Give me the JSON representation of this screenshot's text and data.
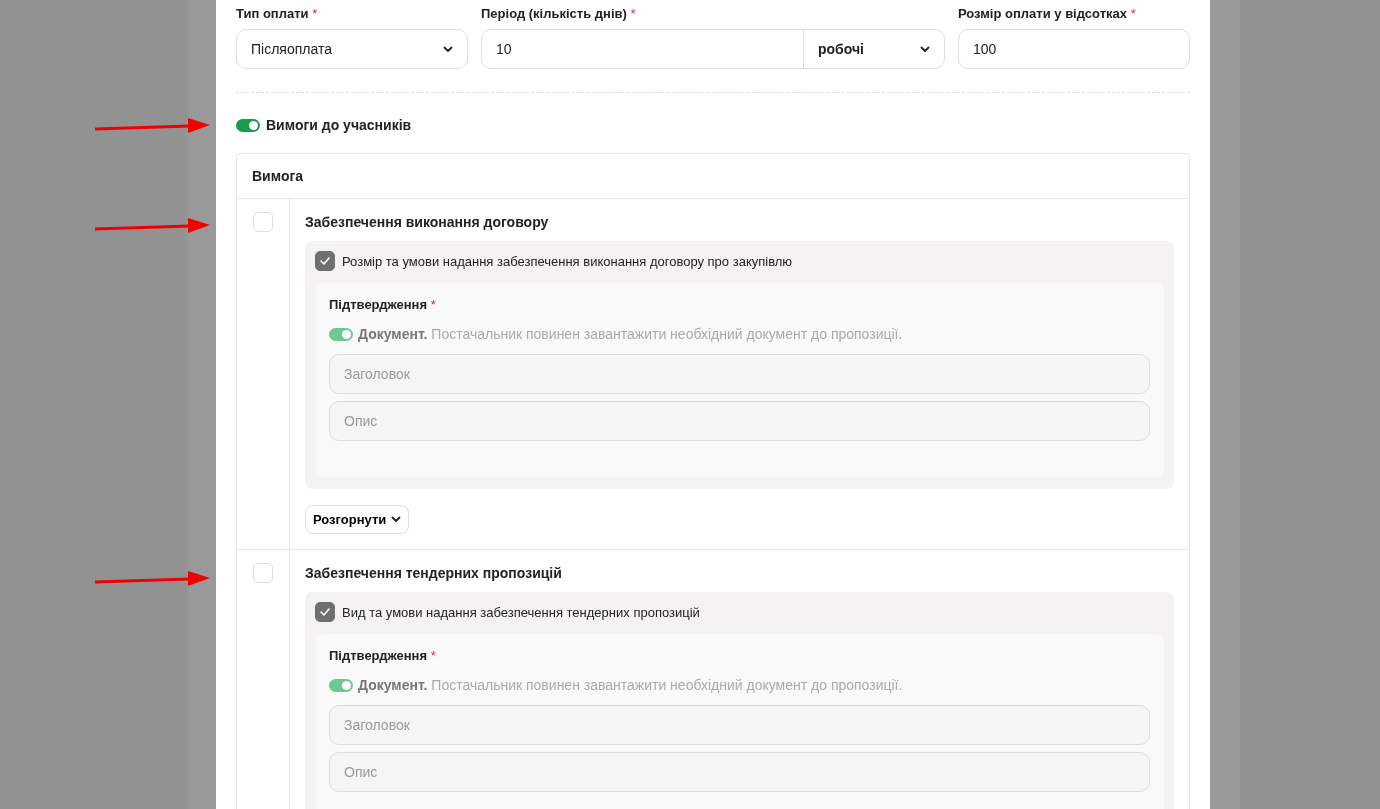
{
  "payment": {
    "fields": [
      {
        "kind": "select",
        "label": "Тип оплати",
        "required_mark": "*",
        "value": "Післяоплата"
      },
      {
        "kind": "number-unit",
        "label": "Період (кількість днів)",
        "required_mark": "*",
        "value": "10",
        "unit": "робочі"
      },
      {
        "kind": "text",
        "label": "Розмір оплати у відсотках",
        "required_mark": "*",
        "value": "100"
      }
    ]
  },
  "requirements_toggle": {
    "label": "Вимоги до учасників",
    "on": true
  },
  "table": {
    "header": "Вимога",
    "rows": [
      {
        "checked": false,
        "title": "Забезпечення виконання договору",
        "criterion": {
          "checked": true,
          "label": "Розмір та умови надання забезпечення виконання договору про закупівлю"
        },
        "confirmation": {
          "label": "Підтвердження",
          "required_mark": "*",
          "document_on": true,
          "document_label": "Документ.",
          "document_text": "Постачальник повинен завантажити необхідний документ до пропозиції.",
          "title_placeholder": "Заголовок",
          "description_placeholder": "Опис"
        },
        "expand_label": "Розгорнути"
      },
      {
        "checked": false,
        "title": "Забезпечення тендерних пропозицій",
        "criterion": {
          "checked": true,
          "label": "Вид та умови надання забезпечення тендерних пропозицій"
        },
        "confirmation": {
          "label": "Підтвердження",
          "required_mark": "*",
          "document_on": true,
          "document_label": "Документ.",
          "document_text": "Постачальник повинен завантажити необхідний документ до пропозиції.",
          "title_placeholder": "Заголовок",
          "description_placeholder": "Опис"
        }
      }
    ]
  }
}
